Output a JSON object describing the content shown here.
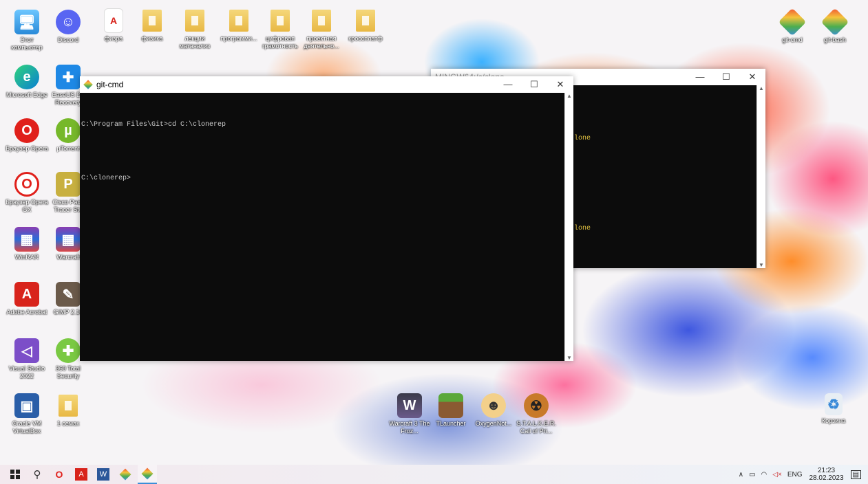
{
  "desktop_icons": {
    "this_pc": "Этот компьютер",
    "discord": "Discord",
    "fizra": "физра",
    "fizika": "физика",
    "lekcii": "лекции матанализ",
    "programm": "программи...",
    "cifrovaya": "цифровая грамотность",
    "proektnaya": "проектная деятельно...",
    "krossplatf": "кроссплатф",
    "edge": "Microsoft Edge",
    "easeus": "EaseUS Da Recovery",
    "opera": "Браузер Opera",
    "utorrent": "µTorrent",
    "operagx": "Браузер Opera GX",
    "cisco": "Cisco Pack Tracer Stu",
    "winrar": "WinRAR",
    "warcraft_arch": "Warcraft",
    "acrobat": "Adobe Acrobat",
    "gimp": "GIMP 2.10",
    "vs": "Visual Studio 2022",
    "s360": "360 Total Security",
    "vbox": "Oracle VM VirtualBox",
    "one_file": "1 семак",
    "warcraft3": "Warcraft 3 The Froz...",
    "tlauncher": "TLauncher",
    "oxygen": "OxygenNot...",
    "stalker": "S.T.A.L.K.E.R. Call of Pri...",
    "gitcmd": "git-cmd",
    "gitbash": "git-bash",
    "recycle": "Корзина"
  },
  "git_cmd_window": {
    "title": "git-cmd",
    "lines": [
      "C:\\Program Files\\Git>cd C:\\clonerep",
      "",
      "C:\\clonerep>"
    ]
  },
  "mingw_window": {
    "title": "MINGW64:/c/clone",
    "lines": [
      "lone",
      "",
      "",
      "lone"
    ]
  },
  "window_controls": {
    "minimize": "—",
    "maximize": "☐",
    "close": "✕"
  },
  "tray": {
    "lang": "ENG",
    "time": "21:23",
    "date": "28.02.2023"
  },
  "colors": {
    "console_bg": "#0c0c0c",
    "console_fg": "#cccccc",
    "mingw_fg": "#e0c040"
  }
}
